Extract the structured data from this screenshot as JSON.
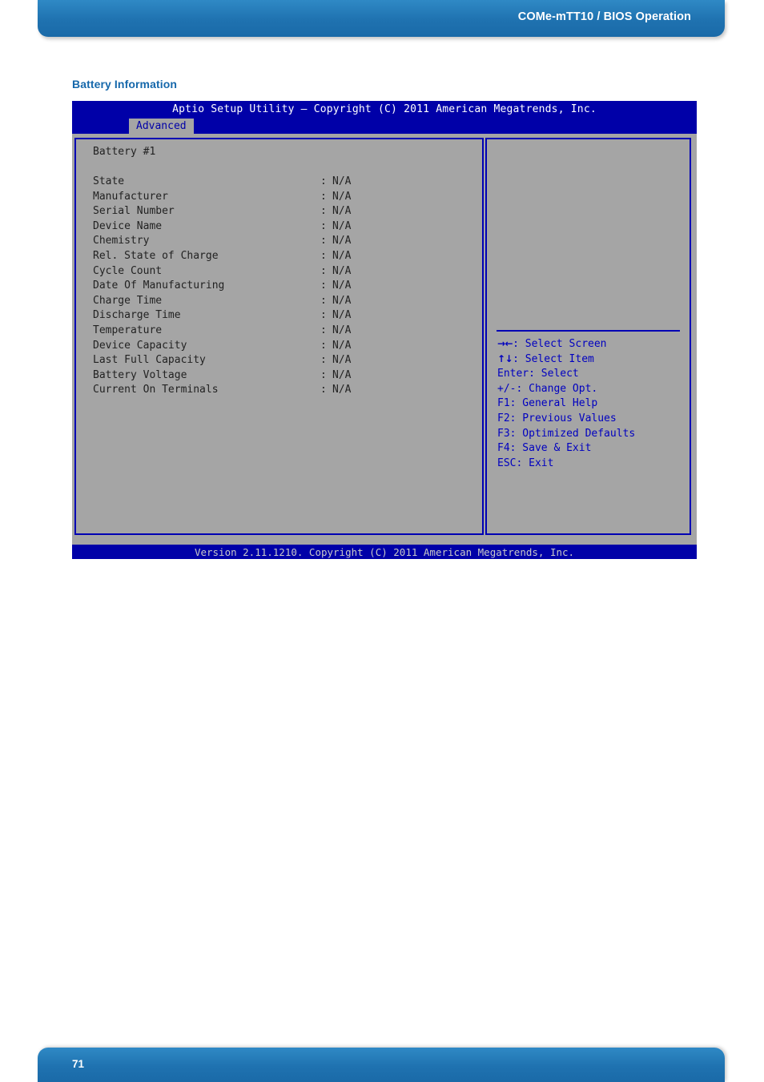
{
  "header": {
    "title": "COMe-mTT10 / BIOS Operation"
  },
  "section": {
    "heading": "Battery Information"
  },
  "bios": {
    "title": "Aptio Setup Utility – Copyright (C) 2011 American Megatrends, Inc.",
    "active_tab": "Advanced",
    "version_bar": "Version 2.11.1210. Copyright (C) 2011 American Megatrends, Inc.",
    "battery_heading": "Battery #1",
    "separator": ":",
    "rows": [
      {
        "label": "State",
        "value": "N/A"
      },
      {
        "label": "Manufacturer",
        "value": "N/A"
      },
      {
        "label": "Serial Number",
        "value": "N/A"
      },
      {
        "label": "Device Name",
        "value": "N/A"
      },
      {
        "label": "Chemistry",
        "value": "N/A"
      },
      {
        "label": "Rel. State of Charge",
        "value": "N/A"
      },
      {
        "label": "Cycle Count",
        "value": "N/A"
      },
      {
        "label": "Date Of Manufacturing",
        "value": "N/A"
      },
      {
        "label": "Charge Time",
        "value": "N/A"
      },
      {
        "label": "Discharge Time",
        "value": "N/A"
      },
      {
        "label": "Temperature",
        "value": "N/A"
      },
      {
        "label": "Device Capacity",
        "value": "N/A"
      },
      {
        "label": "Last Full Capacity",
        "value": "N/A"
      },
      {
        "label": "Battery Voltage",
        "value": "N/A"
      }
    ],
    "help": [
      {
        "keys": "→←",
        "text": ": Select Screen"
      },
      {
        "keys": "↑↓",
        "text": ": Select Item"
      },
      {
        "keys": "",
        "text": "Enter: Select"
      },
      {
        "keys": "",
        "text": "+/-: Change Opt."
      },
      {
        "keys": "",
        "text": "F1: General Help"
      },
      {
        "keys": "",
        "text": "F2: Previous Values"
      },
      {
        "keys": "",
        "text": "F3: Optimized Defaults"
      },
      {
        "keys": "",
        "text": "F4: Save & Exit"
      },
      {
        "keys": "",
        "text": "ESC: Exit"
      }
    ]
  },
  "footer": {
    "page_number": "71"
  },
  "colors": {
    "brand_blue": "#1f72b0",
    "heading_blue": "#1668ab",
    "bios_blue": "#0000a8",
    "bios_border": "#0000b4",
    "bios_gray": "#a5a5a5",
    "help_text": "#0000c0"
  },
  "extra_row": {
    "label": "Current On Terminals",
    "value": "N/A"
  }
}
